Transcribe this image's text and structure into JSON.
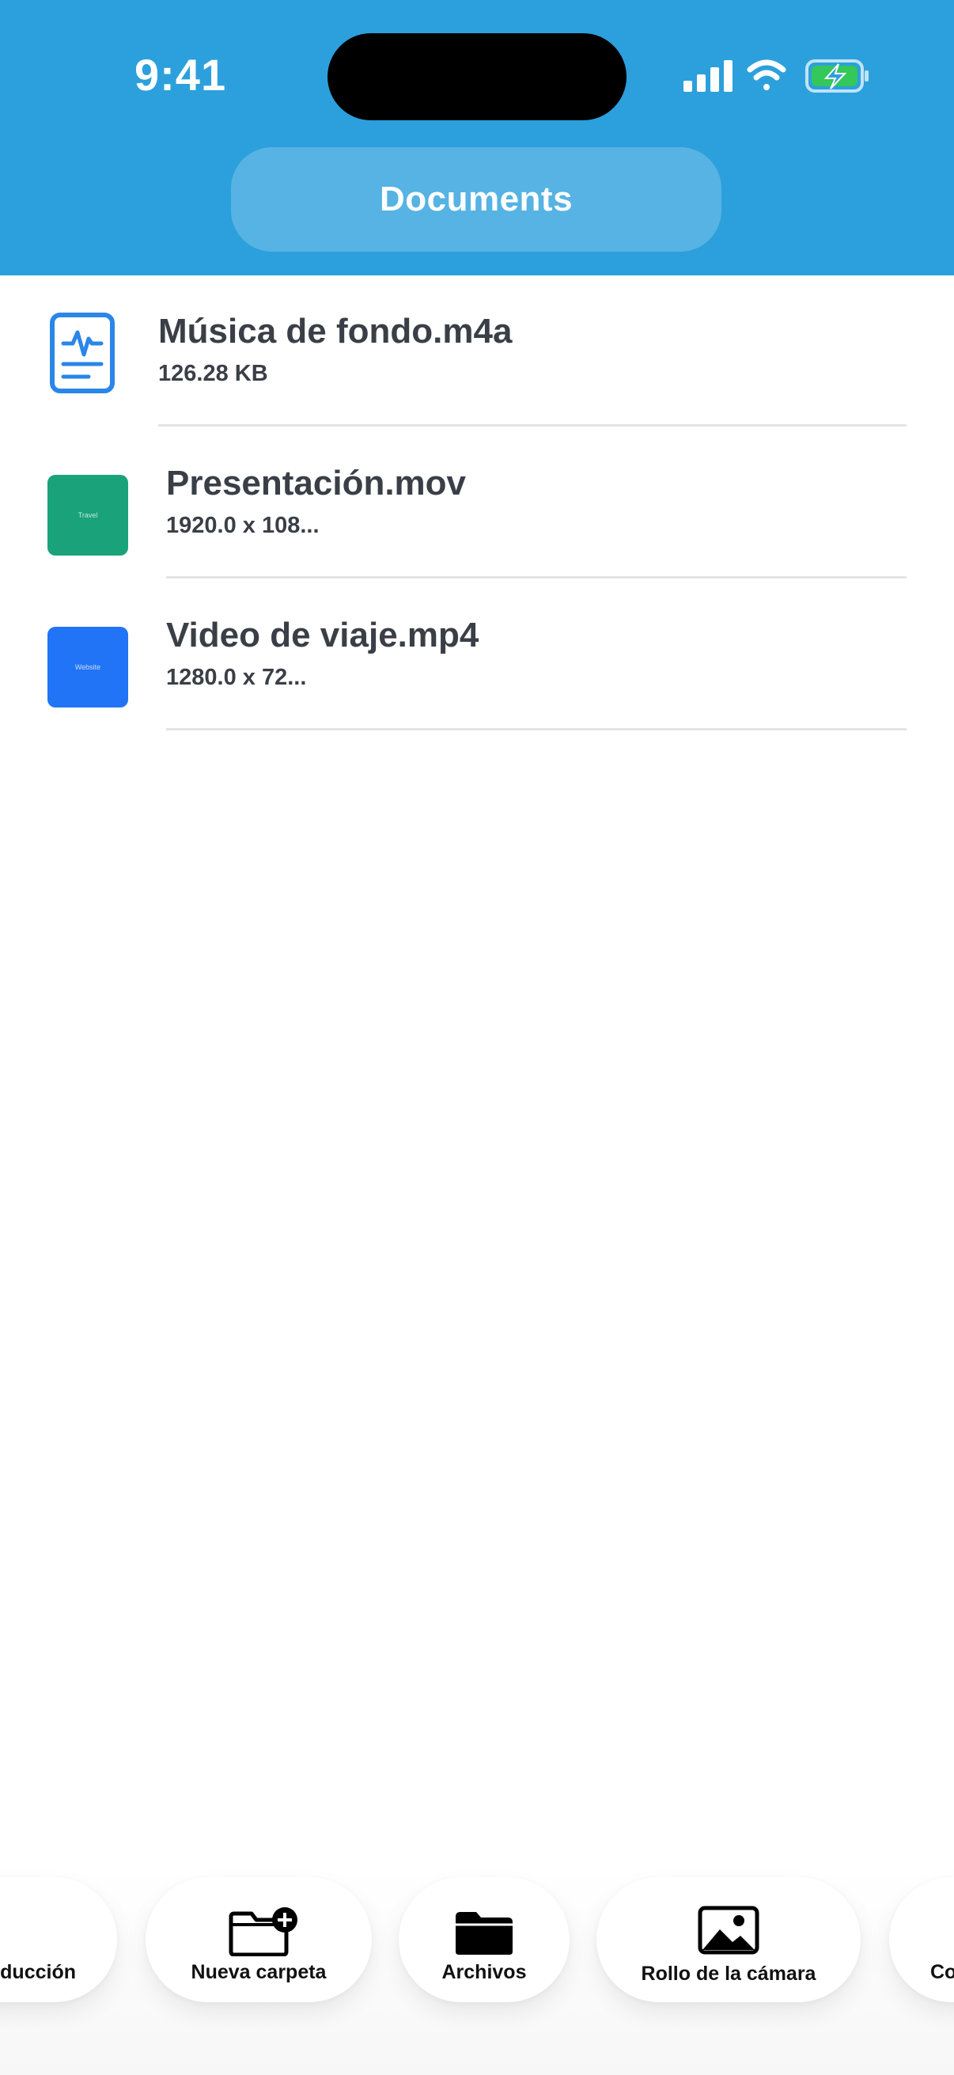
{
  "status_bar": {
    "time": "9:41",
    "icons": [
      "signal-bars-icon",
      "wifi-icon",
      "battery-charging-icon"
    ]
  },
  "header": {
    "title": "Documents",
    "background_color": "#2ca0dc"
  },
  "files": [
    {
      "name": "Música de fondo.m4a",
      "meta": "126.28 KB",
      "icon": "audio-document-icon"
    },
    {
      "name": "Presentación.mov",
      "meta": "1920.0 x 108...",
      "thumbnail_text": "Travel",
      "thumbnail_color": "#1aa27b"
    },
    {
      "name": "Video de viaje.mp4",
      "meta": "1280.0 x 72...",
      "thumbnail_text": "Website",
      "thumbnail_color": "#2174f5"
    }
  ],
  "toolbar": {
    "items": [
      {
        "label": "ducción",
        "icon": ""
      },
      {
        "label": "Nueva carpeta",
        "icon": "new-folder-icon"
      },
      {
        "label": "Archivos",
        "icon": "folder-icon"
      },
      {
        "label": "Rollo de la cámara",
        "icon": "photo-icon"
      },
      {
        "label": "Co",
        "icon": ""
      }
    ]
  }
}
